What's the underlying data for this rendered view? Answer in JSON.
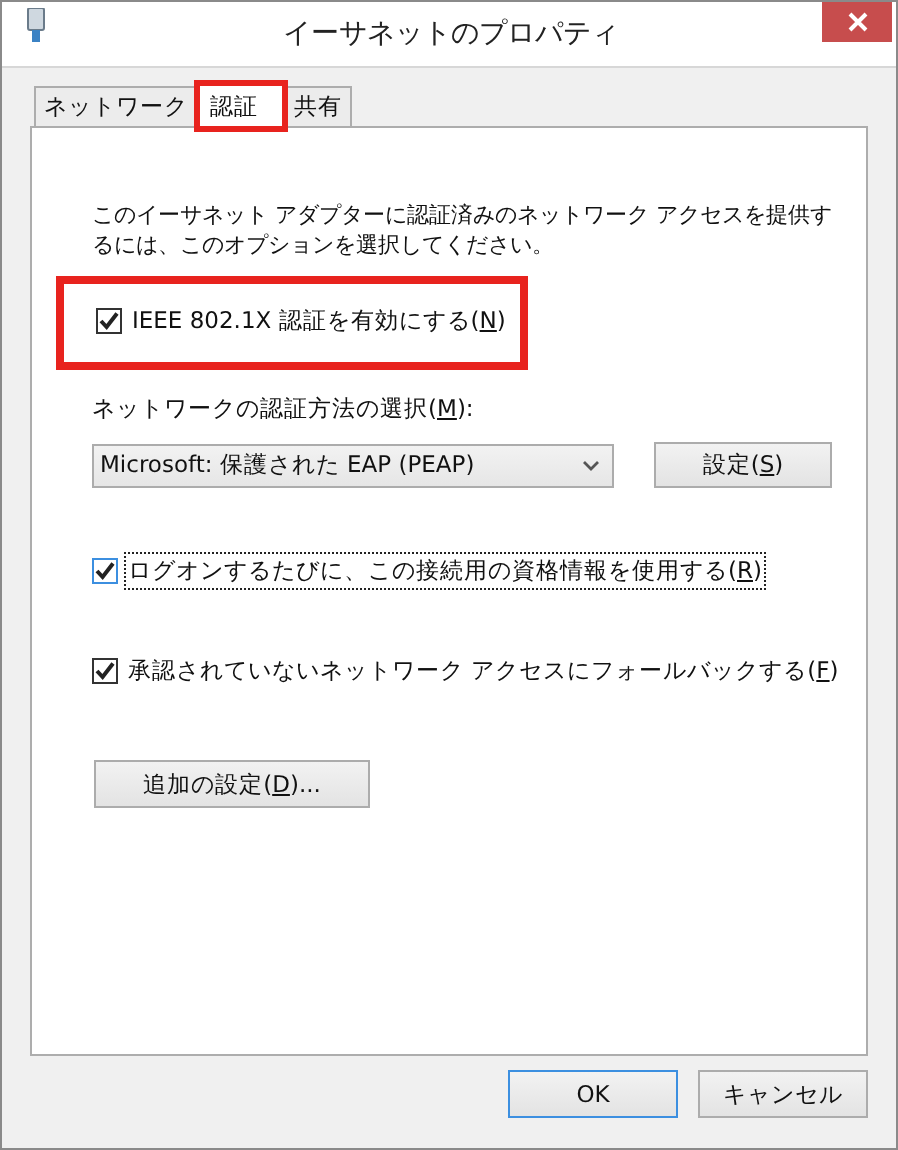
{
  "window": {
    "title": "イーサネットのプロパティ"
  },
  "tabs": [
    {
      "label": "ネットワーク",
      "selected": false,
      "highlighted": false
    },
    {
      "label": "認証",
      "selected": true,
      "highlighted": true
    },
    {
      "label": "共有",
      "selected": false,
      "highlighted": false
    }
  ],
  "description": "このイーサネット アダプターに認証済みのネットワーク アクセスを提供するには、このオプションを選択してください。",
  "enable_checkbox": {
    "before": "IEEE 802.1X 認証を有効にする(",
    "key": "N",
    "after": ")",
    "checked": true,
    "highlighted": true
  },
  "method": {
    "before": "ネットワークの認証方法の選択(",
    "key": "M",
    "after": "):",
    "value": "Microsoft: 保護された EAP (PEAP)",
    "settings_button": {
      "before": "設定(",
      "key": "S",
      "after": ")"
    }
  },
  "options": [
    {
      "before": "ログオンするたびに、この接続用の資格情報を使用する(",
      "key": "R",
      "after": ")",
      "checked": true,
      "focused": true
    },
    {
      "before": "承認されていないネットワーク アクセスにフォールバックする(",
      "key": "F",
      "after": ")",
      "checked": true,
      "focused": false
    }
  ],
  "additional_button": {
    "before": "追加の設定(",
    "key": "D",
    "after": ")..."
  },
  "buttons": [
    {
      "label": "OK",
      "default": true
    },
    {
      "label": "キャンセル",
      "default": false
    }
  ]
}
